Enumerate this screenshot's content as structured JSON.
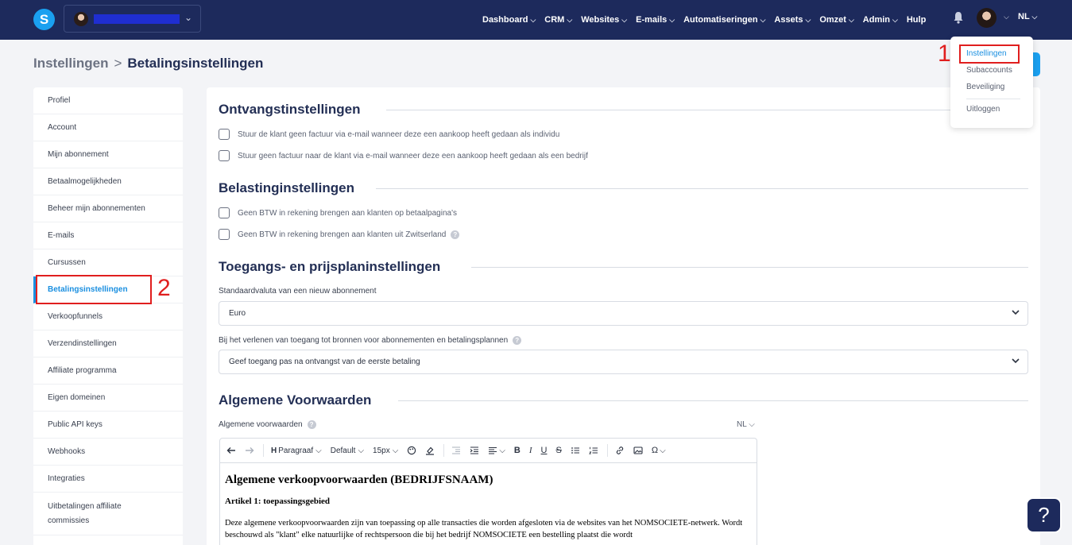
{
  "topbar": {
    "logo_letter": "S",
    "nav": [
      {
        "label": "Dashboard"
      },
      {
        "label": "CRM"
      },
      {
        "label": "Websites"
      },
      {
        "label": "E-mails"
      },
      {
        "label": "Automatiseringen"
      },
      {
        "label": "Assets"
      },
      {
        "label": "Omzet"
      },
      {
        "label": "Admin"
      }
    ],
    "help_label": "Hulp",
    "language": "NL"
  },
  "breadcrumb": {
    "parent": "Instellingen",
    "separator": ">",
    "current": "Betalingsinstellingen"
  },
  "sidebar": {
    "items": [
      {
        "label": "Profiel"
      },
      {
        "label": "Account"
      },
      {
        "label": "Mijn abonnement"
      },
      {
        "label": "Betaalmogelijkheden"
      },
      {
        "label": "Beheer mijn abonnementen"
      },
      {
        "label": "E-mails"
      },
      {
        "label": "Cursussen"
      },
      {
        "label": "Betalingsinstellingen",
        "active": true
      },
      {
        "label": "Verkoopfunnels"
      },
      {
        "label": "Verzendinstellingen"
      },
      {
        "label": "Affiliate programma"
      },
      {
        "label": "Eigen domeinen"
      },
      {
        "label": "Public API keys"
      },
      {
        "label": "Webhooks"
      },
      {
        "label": "Integraties"
      },
      {
        "label": "Uitbetalingen affiliate commissies"
      }
    ]
  },
  "main": {
    "receipt": {
      "title": "Ontvangstinstellingen",
      "options": [
        "Stuur de klant geen factuur via e-mail wanneer deze een aankoop heeft gedaan als individu",
        "Stuur geen factuur naar de klant via e-mail wanneer deze een aankoop heeft gedaan als een bedrijf"
      ]
    },
    "tax": {
      "title": "Belastinginstellingen",
      "options": [
        "Geen BTW in rekening brengen aan klanten op betaalpagina's",
        "Geen BTW in rekening brengen aan klanten uit Zwitserland"
      ]
    },
    "access": {
      "title": "Toegangs- en prijsplaninstellingen",
      "currency_label": "Standaardvaluta van een nieuw abonnement",
      "currency_value": "Euro",
      "grant_label": "Bij het verlenen van toegang tot bronnen voor abonnementen en betalingsplannen",
      "grant_value": "Geef toegang  pas na ontvangst van de eerste betaling"
    },
    "terms": {
      "title": "Algemene Voorwaarden",
      "label": "Algemene voorwaarden",
      "language": "NL",
      "toolbar": {
        "paragraph": "Paragraaf",
        "font": "Default",
        "size": "15px"
      },
      "content": {
        "heading": "Algemene verkoopvoorwaarden (BEDRIJFSNAAM)",
        "subheading": "Artikel 1: toepassingsgebied",
        "paragraph": "Deze algemene verkoopvoorwaarden zijn van toepassing op alle transacties die worden afgesloten via de websites van het NOMSOCIETE-netwerk. Wordt beschouwd als \"klant\" elke natuurlijke of rechtspersoon die bij het bedrijf NOMSOCIETE een bestelling plaatst die wordt"
      }
    }
  },
  "dropdown": {
    "items": [
      "Instellingen",
      "Subaccounts",
      "Beveiliging",
      "Uitloggen"
    ]
  },
  "annotations": {
    "one": "1",
    "two": "2"
  },
  "help_fab": "?",
  "colors": {
    "topbar": "#1d2a5c",
    "accent": "#1a8fe0",
    "annotation": "#e01e1e"
  }
}
